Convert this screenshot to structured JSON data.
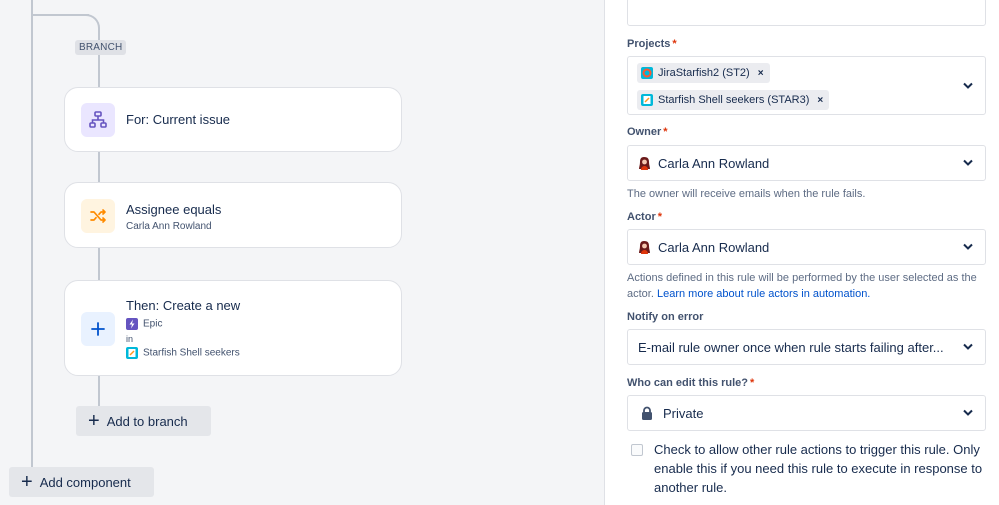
{
  "canvas": {
    "branch_label": "BRANCH",
    "cards": [
      {
        "title": "For: Current issue",
        "icon": "hierarchy-icon"
      },
      {
        "title": "Assignee equals",
        "subtitle": "Carla Ann Rowland",
        "icon": "shuffle-icon"
      },
      {
        "title": "Then: Create a new",
        "issue_type": "Epic",
        "in_label": "in",
        "project": "Starfish Shell seekers",
        "icon": "plus-icon"
      }
    ],
    "add_to_branch": "Add to branch",
    "add_component": "Add component"
  },
  "panel": {
    "projects": {
      "label": "Projects",
      "tags": [
        {
          "label": "JiraStarfish2 (ST2)",
          "remove": "×"
        },
        {
          "label": "Starfish Shell seekers (STAR3)",
          "remove": "×"
        }
      ]
    },
    "owner": {
      "label": "Owner",
      "value": "Carla Ann Rowland",
      "helper": "The owner will receive emails when the rule fails."
    },
    "actor": {
      "label": "Actor",
      "value": "Carla Ann Rowland",
      "helper": "Actions defined in this rule will be performed by the user selected as the actor.",
      "link": "Learn more about rule actors in automation."
    },
    "notify": {
      "label": "Notify on error",
      "value": "E-mail rule owner once when rule starts failing after..."
    },
    "who_can_edit": {
      "label": "Who can edit this rule?",
      "value": "Private"
    },
    "allow_trigger": {
      "text": "Check to allow other rule actions to trigger this rule. Only enable this if you need this rule to execute in response to another rule.",
      "checked": false
    },
    "required_mark": "*"
  },
  "colors": {
    "accent_purple": "#6554c0",
    "accent_orange": "#ff8b00",
    "accent_blue": "#0052cc",
    "required": "#de350b"
  }
}
